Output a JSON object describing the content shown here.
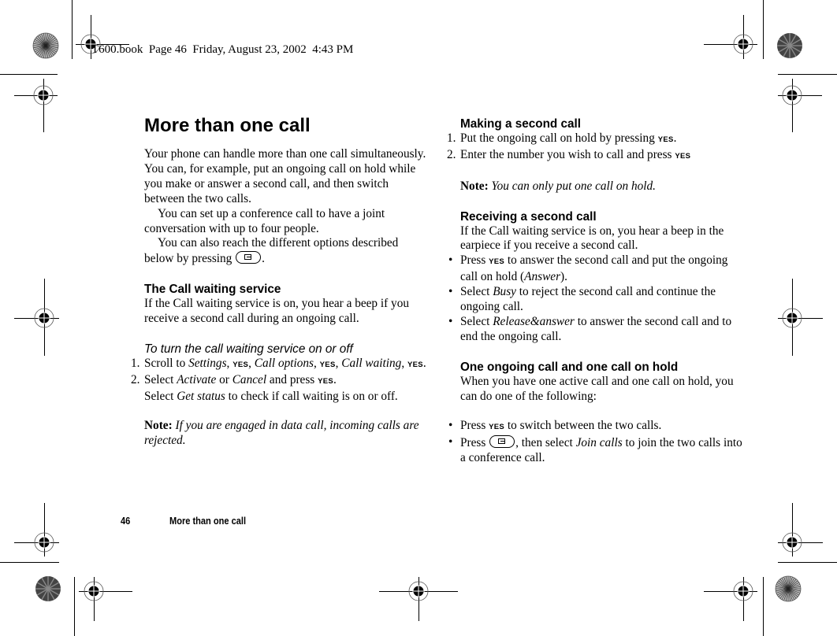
{
  "print_slug": "T600.book  Page 46  Friday, August 23, 2002  4:43 PM",
  "left": {
    "title": "More than one call",
    "intro": [
      "Your phone can handle more than one call simultaneously. You can, for example, put an ongoing call on hold while you make or answer a second call, and then switch between the two calls.",
      "You can set up a conference call to have a joint conversation with up to four people.",
      "You can also reach the different options described below by pressing"
    ],
    "intro_end": ".",
    "call_waiting": {
      "heading": "The Call waiting service",
      "text": "If the Call waiting service is on, you hear a beep if you receive a second call during an ongoing call.",
      "subheading": "To turn the call waiting service on or off",
      "steps": [
        {
          "num": "1.",
          "parts": [
            "Scroll to ",
            "Settings",
            ", ",
            "YES",
            ", ",
            "Call options",
            ", ",
            "YES",
            ", ",
            "Call waiting",
            ", ",
            "YES",
            "."
          ]
        },
        {
          "num": "2.",
          "parts": [
            "Select ",
            "Activate",
            " or ",
            "Cancel",
            " and press ",
            "YES",
            "."
          ],
          "extra": [
            "Select ",
            "Get status",
            " to check if call waiting is on or off."
          ]
        }
      ],
      "note_label": "Note:",
      "note_text": "If you are engaged in data call, incoming calls are rejected."
    }
  },
  "right": {
    "making": {
      "heading": "Making a second call",
      "steps": [
        {
          "num": "1.",
          "text": "Put the ongoing call on hold by pressing ",
          "key": "YES",
          "end": "."
        },
        {
          "num": "2.",
          "text": "Enter the number you wish to call and press ",
          "key": "YES",
          "end": ""
        }
      ],
      "note_label": "Note:",
      "note_text": "You can only put one call on hold."
    },
    "receiving": {
      "heading": "Receiving a second call",
      "text": "If the Call waiting service is on, you hear a beep in the earpiece if you receive a second call.",
      "bullets": [
        {
          "a": "Press ",
          "key": "YES",
          "b": " to answer the second call and put the ongoing call on hold (",
          "em": "Answer",
          "c": ")."
        },
        {
          "a": "Select ",
          "em": "Busy",
          "c": " to reject the second call and continue the ongoing call."
        },
        {
          "a": "Select ",
          "em": "Release&answer",
          "c": " to answer the second call and to end the ongoing call."
        }
      ]
    },
    "hold": {
      "heading": "One ongoing call and one call on hold",
      "text": "When you have one active call and one call on hold, you can do one of the following:",
      "bullets": [
        {
          "a": "Press ",
          "key": "YES",
          "c": " to switch between the two calls."
        },
        {
          "a": "Press ",
          "b": ", then select ",
          "em": "Join calls",
          "c": " to join the two calls into a conference call."
        }
      ]
    }
  },
  "footer": {
    "page_number": "46",
    "running_title": "More than one call"
  },
  "icons": {
    "menu_key": "menu-key-icon",
    "registration_mark": "registration-crosshair-icon",
    "color_bar": "starburst-target-icon"
  }
}
